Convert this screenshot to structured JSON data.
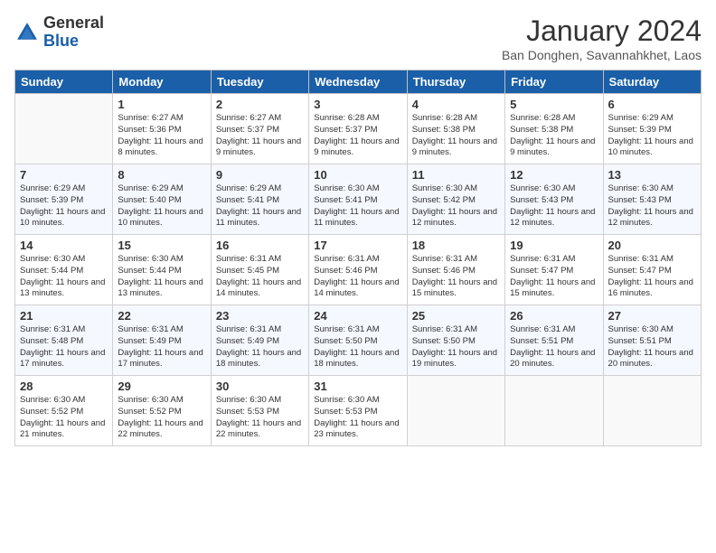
{
  "header": {
    "logo_general": "General",
    "logo_blue": "Blue",
    "month_title": "January 2024",
    "subtitle": "Ban Donghen, Savannahkhet, Laos"
  },
  "days_of_week": [
    "Sunday",
    "Monday",
    "Tuesday",
    "Wednesday",
    "Thursday",
    "Friday",
    "Saturday"
  ],
  "weeks": [
    [
      {
        "day": "",
        "sunrise": "",
        "sunset": "",
        "daylight": "",
        "empty": true
      },
      {
        "day": "1",
        "sunrise": "Sunrise: 6:27 AM",
        "sunset": "Sunset: 5:36 PM",
        "daylight": "Daylight: 11 hours and 8 minutes."
      },
      {
        "day": "2",
        "sunrise": "Sunrise: 6:27 AM",
        "sunset": "Sunset: 5:37 PM",
        "daylight": "Daylight: 11 hours and 9 minutes."
      },
      {
        "day": "3",
        "sunrise": "Sunrise: 6:28 AM",
        "sunset": "Sunset: 5:37 PM",
        "daylight": "Daylight: 11 hours and 9 minutes."
      },
      {
        "day": "4",
        "sunrise": "Sunrise: 6:28 AM",
        "sunset": "Sunset: 5:38 PM",
        "daylight": "Daylight: 11 hours and 9 minutes."
      },
      {
        "day": "5",
        "sunrise": "Sunrise: 6:28 AM",
        "sunset": "Sunset: 5:38 PM",
        "daylight": "Daylight: 11 hours and 9 minutes."
      },
      {
        "day": "6",
        "sunrise": "Sunrise: 6:29 AM",
        "sunset": "Sunset: 5:39 PM",
        "daylight": "Daylight: 11 hours and 10 minutes."
      }
    ],
    [
      {
        "day": "7",
        "sunrise": "Sunrise: 6:29 AM",
        "sunset": "Sunset: 5:39 PM",
        "daylight": "Daylight: 11 hours and 10 minutes."
      },
      {
        "day": "8",
        "sunrise": "Sunrise: 6:29 AM",
        "sunset": "Sunset: 5:40 PM",
        "daylight": "Daylight: 11 hours and 10 minutes."
      },
      {
        "day": "9",
        "sunrise": "Sunrise: 6:29 AM",
        "sunset": "Sunset: 5:41 PM",
        "daylight": "Daylight: 11 hours and 11 minutes."
      },
      {
        "day": "10",
        "sunrise": "Sunrise: 6:30 AM",
        "sunset": "Sunset: 5:41 PM",
        "daylight": "Daylight: 11 hours and 11 minutes."
      },
      {
        "day": "11",
        "sunrise": "Sunrise: 6:30 AM",
        "sunset": "Sunset: 5:42 PM",
        "daylight": "Daylight: 11 hours and 12 minutes."
      },
      {
        "day": "12",
        "sunrise": "Sunrise: 6:30 AM",
        "sunset": "Sunset: 5:43 PM",
        "daylight": "Daylight: 11 hours and 12 minutes."
      },
      {
        "day": "13",
        "sunrise": "Sunrise: 6:30 AM",
        "sunset": "Sunset: 5:43 PM",
        "daylight": "Daylight: 11 hours and 12 minutes."
      }
    ],
    [
      {
        "day": "14",
        "sunrise": "Sunrise: 6:30 AM",
        "sunset": "Sunset: 5:44 PM",
        "daylight": "Daylight: 11 hours and 13 minutes."
      },
      {
        "day": "15",
        "sunrise": "Sunrise: 6:30 AM",
        "sunset": "Sunset: 5:44 PM",
        "daylight": "Daylight: 11 hours and 13 minutes."
      },
      {
        "day": "16",
        "sunrise": "Sunrise: 6:31 AM",
        "sunset": "Sunset: 5:45 PM",
        "daylight": "Daylight: 11 hours and 14 minutes."
      },
      {
        "day": "17",
        "sunrise": "Sunrise: 6:31 AM",
        "sunset": "Sunset: 5:46 PM",
        "daylight": "Daylight: 11 hours and 14 minutes."
      },
      {
        "day": "18",
        "sunrise": "Sunrise: 6:31 AM",
        "sunset": "Sunset: 5:46 PM",
        "daylight": "Daylight: 11 hours and 15 minutes."
      },
      {
        "day": "19",
        "sunrise": "Sunrise: 6:31 AM",
        "sunset": "Sunset: 5:47 PM",
        "daylight": "Daylight: 11 hours and 15 minutes."
      },
      {
        "day": "20",
        "sunrise": "Sunrise: 6:31 AM",
        "sunset": "Sunset: 5:47 PM",
        "daylight": "Daylight: 11 hours and 16 minutes."
      }
    ],
    [
      {
        "day": "21",
        "sunrise": "Sunrise: 6:31 AM",
        "sunset": "Sunset: 5:48 PM",
        "daylight": "Daylight: 11 hours and 17 minutes."
      },
      {
        "day": "22",
        "sunrise": "Sunrise: 6:31 AM",
        "sunset": "Sunset: 5:49 PM",
        "daylight": "Daylight: 11 hours and 17 minutes."
      },
      {
        "day": "23",
        "sunrise": "Sunrise: 6:31 AM",
        "sunset": "Sunset: 5:49 PM",
        "daylight": "Daylight: 11 hours and 18 minutes."
      },
      {
        "day": "24",
        "sunrise": "Sunrise: 6:31 AM",
        "sunset": "Sunset: 5:50 PM",
        "daylight": "Daylight: 11 hours and 18 minutes."
      },
      {
        "day": "25",
        "sunrise": "Sunrise: 6:31 AM",
        "sunset": "Sunset: 5:50 PM",
        "daylight": "Daylight: 11 hours and 19 minutes."
      },
      {
        "day": "26",
        "sunrise": "Sunrise: 6:31 AM",
        "sunset": "Sunset: 5:51 PM",
        "daylight": "Daylight: 11 hours and 20 minutes."
      },
      {
        "day": "27",
        "sunrise": "Sunrise: 6:30 AM",
        "sunset": "Sunset: 5:51 PM",
        "daylight": "Daylight: 11 hours and 20 minutes."
      }
    ],
    [
      {
        "day": "28",
        "sunrise": "Sunrise: 6:30 AM",
        "sunset": "Sunset: 5:52 PM",
        "daylight": "Daylight: 11 hours and 21 minutes."
      },
      {
        "day": "29",
        "sunrise": "Sunrise: 6:30 AM",
        "sunset": "Sunset: 5:52 PM",
        "daylight": "Daylight: 11 hours and 22 minutes."
      },
      {
        "day": "30",
        "sunrise": "Sunrise: 6:30 AM",
        "sunset": "Sunset: 5:53 PM",
        "daylight": "Daylight: 11 hours and 22 minutes."
      },
      {
        "day": "31",
        "sunrise": "Sunrise: 6:30 AM",
        "sunset": "Sunset: 5:53 PM",
        "daylight": "Daylight: 11 hours and 23 minutes."
      },
      {
        "day": "",
        "sunrise": "",
        "sunset": "",
        "daylight": "",
        "empty": true
      },
      {
        "day": "",
        "sunrise": "",
        "sunset": "",
        "daylight": "",
        "empty": true
      },
      {
        "day": "",
        "sunrise": "",
        "sunset": "",
        "daylight": "",
        "empty": true
      }
    ]
  ]
}
